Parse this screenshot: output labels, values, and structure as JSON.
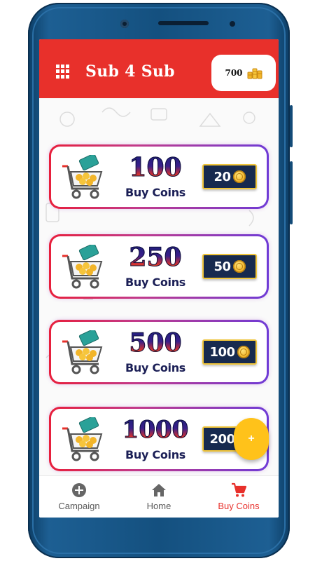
{
  "app": {
    "title": "Sub 4 Sub",
    "coin_balance": "700"
  },
  "icons": {
    "menu": "grid-menu-icon",
    "balance": "coin-stack-icon",
    "cart": "shopping-cart-icon",
    "coin": "coin-icon",
    "fab": "plus-icon"
  },
  "colors": {
    "appbar": "#e8302b",
    "card_border_start": "#e81f3b",
    "card_border_end": "#6f3bd6",
    "price_badge": "#172a4f",
    "price_badge_border": "#f0c53a",
    "fab": "#ffc21a",
    "nav_active": "#e8302b"
  },
  "packages": [
    {
      "amount": "100",
      "label": "Buy Coins",
      "price": "20"
    },
    {
      "amount": "250",
      "label": "Buy Coins",
      "price": "50"
    },
    {
      "amount": "500",
      "label": "Buy Coins",
      "price": "100"
    },
    {
      "amount": "1000",
      "label": "Buy Coins",
      "price": "200"
    }
  ],
  "fab": {
    "label": "+"
  },
  "nav": {
    "items": [
      {
        "label": "Campaign",
        "icon": "add-circle-icon",
        "active": false
      },
      {
        "label": "Home",
        "icon": "home-icon",
        "active": false
      },
      {
        "label": "Buy Coins",
        "icon": "cart-icon",
        "active": true
      }
    ]
  }
}
